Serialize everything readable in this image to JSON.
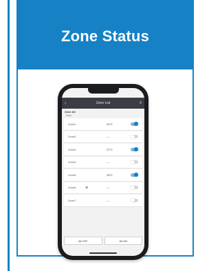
{
  "card": {
    "title": "Zone Status"
  },
  "app": {
    "title": "Zone List",
    "back_icon": "‹",
    "menu_icon": "≡",
    "section_title": "Zone Air",
    "section_sub": "Zone"
  },
  "zones": [
    {
      "name": "Zone1",
      "icon": "",
      "temp": "24°C",
      "on": true
    },
    {
      "name": "Zone2",
      "icon": "",
      "temp": "—",
      "on": false
    },
    {
      "name": "Zone3",
      "icon": "",
      "temp": "27°C",
      "on": true
    },
    {
      "name": "Zone4",
      "icon": "",
      "temp": "—",
      "on": false
    },
    {
      "name": "Zone5",
      "icon": "",
      "temp": "25°C",
      "on": true
    },
    {
      "name": "Zone6",
      "icon": "⊕",
      "temp": "—",
      "on": false
    },
    {
      "name": "Zone7",
      "icon": "",
      "temp": "—",
      "on": false
    }
  ],
  "buttons": {
    "all_off": "All OFF",
    "all_on": "All ON"
  },
  "colors": {
    "accent": "#1681c5"
  }
}
